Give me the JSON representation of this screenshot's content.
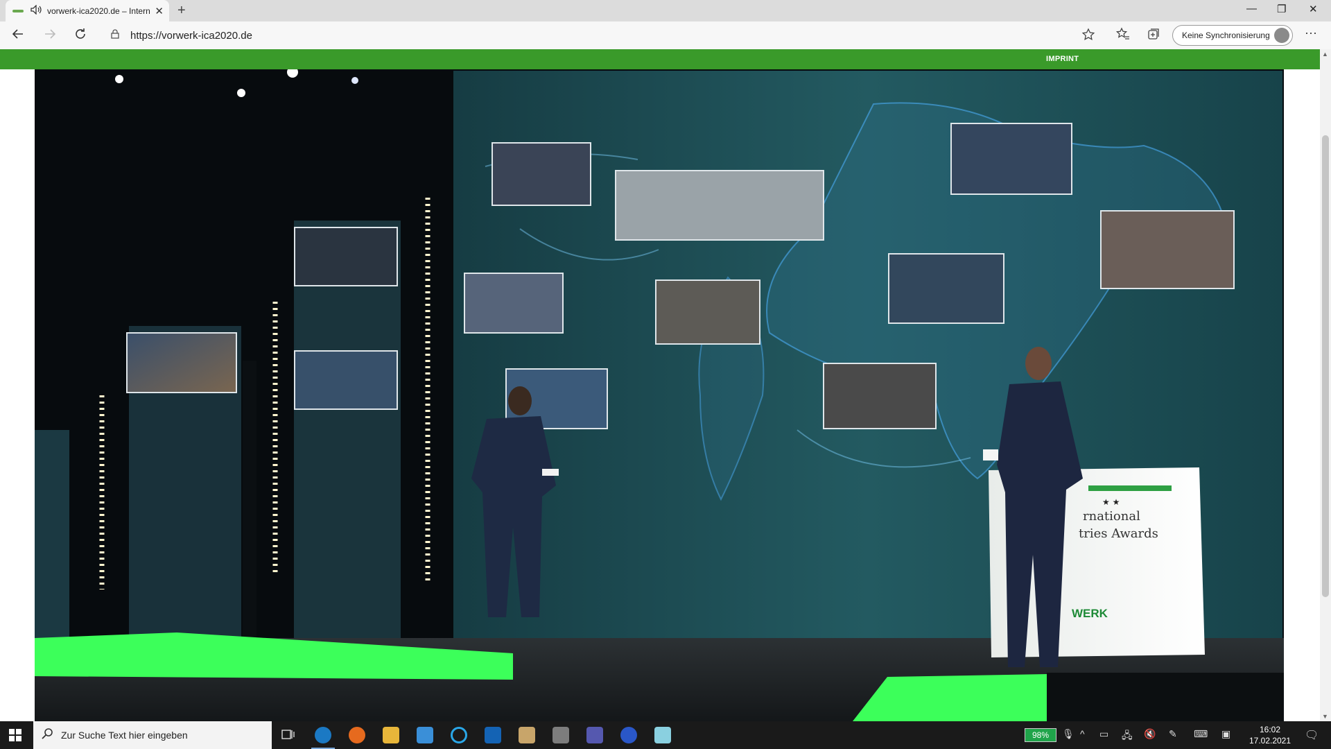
{
  "browser": {
    "tab_title": "vorwerk-ica2020.de – Intern",
    "tab_close": "✕",
    "new_tab": "+",
    "url": "https://vorwerk-ica2020.de",
    "sync_label": "Keine Synchronisierung",
    "more": "···",
    "window": {
      "minimize": "—",
      "restore": "❐",
      "close": "✕"
    }
  },
  "page": {
    "imprint_label": "IMPRINT",
    "podium_line1": "rnational",
    "podium_line2": "tries Awards",
    "podium_logo": "WERK",
    "podium_stars": "★ ★"
  },
  "taskbar": {
    "search_placeholder": "Zur Suche Text hier eingeben",
    "battery": "98%",
    "time": "16:02",
    "date": "17.02.2021"
  },
  "colors": {
    "brand_green": "#3a9a2a",
    "stage_green": "#3cff5a",
    "screen_teal": "#1f4f55"
  }
}
